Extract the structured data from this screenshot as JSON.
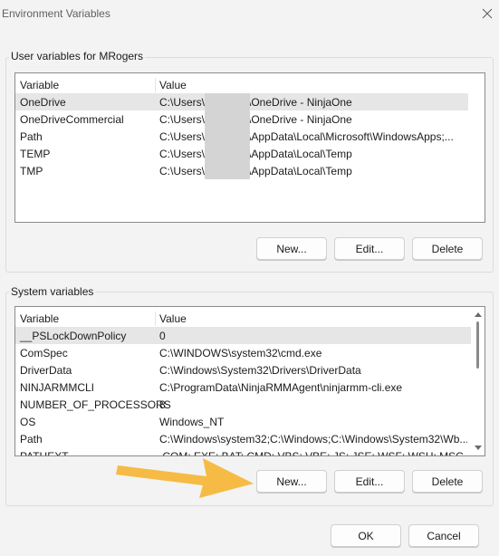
{
  "window": {
    "title": "Environment Variables"
  },
  "user_vars": {
    "label": "User variables for MRogers",
    "columns": {
      "variable": "Variable",
      "value": "Value"
    },
    "rows": [
      {
        "variable": "OneDrive",
        "value_prefix": "C:\\Users\\",
        "value_suffix": "\\OneDrive - NinjaOne",
        "selected": true
      },
      {
        "variable": "OneDriveCommercial",
        "value_prefix": "C:\\Users\\",
        "value_suffix": "\\OneDrive - NinjaOne"
      },
      {
        "variable": "Path",
        "value_prefix": "C:\\Users\\",
        "value_suffix": "\\AppData\\Local\\Microsoft\\WindowsApps;..."
      },
      {
        "variable": "TEMP",
        "value_prefix": "C:\\Users\\",
        "value_suffix": "\\AppData\\Local\\Temp"
      },
      {
        "variable": "TMP",
        "value_prefix": "C:\\Users\\",
        "value_suffix": "\\AppData\\Local\\Temp"
      }
    ],
    "buttons": {
      "new": "New...",
      "edit": "Edit...",
      "delete": "Delete"
    }
  },
  "system_vars": {
    "label": "System variables",
    "columns": {
      "variable": "Variable",
      "value": "Value"
    },
    "rows": [
      {
        "variable": "__PSLockDownPolicy",
        "value": "0",
        "selected": true
      },
      {
        "variable": "ComSpec",
        "value": "C:\\WINDOWS\\system32\\cmd.exe"
      },
      {
        "variable": "DriverData",
        "value": "C:\\Windows\\System32\\Drivers\\DriverData"
      },
      {
        "variable": "NINJARMMCLI",
        "value": "C:\\ProgramData\\NinjaRMMAgent\\ninjarmm-cli.exe"
      },
      {
        "variable": "NUMBER_OF_PROCESSORS",
        "value": "8"
      },
      {
        "variable": "OS",
        "value": "Windows_NT"
      },
      {
        "variable": "Path",
        "value": "C:\\Windows\\system32;C:\\Windows;C:\\Windows\\System32\\Wb..."
      },
      {
        "variable": "PATHEXT",
        "value": ".COM;.EXE;.BAT;.CMD;.VBS;.VBE;.JS;.JSE;.WSF;.WSH;.MSC"
      }
    ],
    "buttons": {
      "new": "New...",
      "edit": "Edit...",
      "delete": "Delete"
    }
  },
  "footer": {
    "ok": "OK",
    "cancel": "Cancel"
  },
  "colors": {
    "accent_arrow": "#f5b73a",
    "selected_row": "#e6e6e6"
  },
  "icons": {
    "close": "close-icon",
    "scroll_up": "chevron-up-icon",
    "scroll_down": "chevron-down-icon",
    "annotation": "arrow-annotation"
  }
}
